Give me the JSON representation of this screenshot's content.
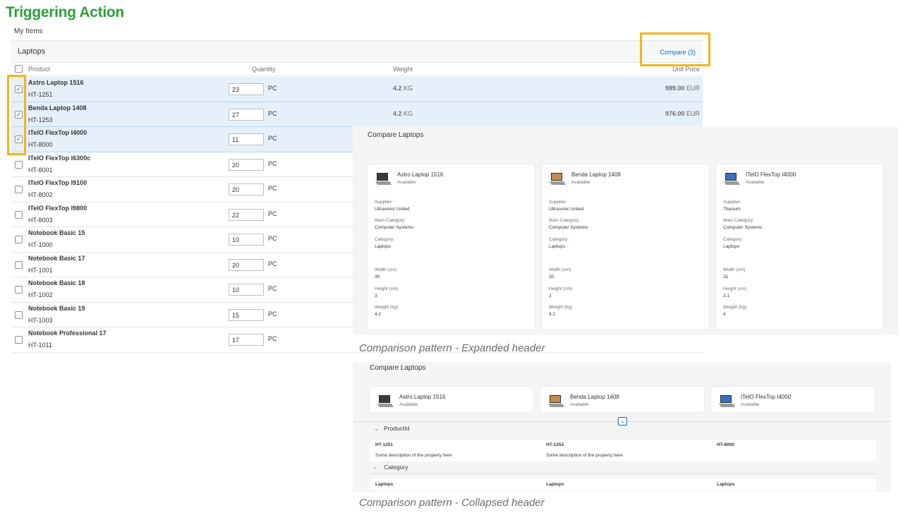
{
  "slide_title": "Triggering Action",
  "items": {
    "heading": "My Items",
    "toolbar_title": "Laptops",
    "compare_label": "Compare (3)",
    "columns": {
      "product": "Product",
      "quantity": "Quantity",
      "weight": "Weight",
      "unit_price": "Unit Price"
    },
    "rows": [
      {
        "name": "Astro Laptop 1516",
        "id": "HT-1251",
        "qty": "23",
        "unit": "PC",
        "weight": "4.2",
        "weight_unit": "KG",
        "price": "989.00",
        "currency": "EUR",
        "selected": true
      },
      {
        "name": "Benda Laptop 1408",
        "id": "HT-1253",
        "qty": "27",
        "unit": "PC",
        "weight": "4.2",
        "weight_unit": "KG",
        "price": "976.00",
        "currency": "EUR",
        "selected": true
      },
      {
        "name": "ITelO FlexTop I4000",
        "id": "HT-8000",
        "qty": "11",
        "unit": "PC",
        "selected": true
      },
      {
        "name": "ITelO FlexTop I6300c",
        "id": "HT-8001",
        "qty": "20",
        "unit": "PC",
        "selected": false
      },
      {
        "name": "ITelO FlexTop I9100",
        "id": "HT-8002",
        "qty": "20",
        "unit": "PC",
        "selected": false
      },
      {
        "name": "ITelO FlexTop I9800",
        "id": "HT-8003",
        "qty": "22",
        "unit": "PC",
        "selected": false
      },
      {
        "name": "Notebook Basic 15",
        "id": "HT-1000",
        "qty": "10",
        "unit": "PC",
        "selected": false
      },
      {
        "name": "Notebook Basic 17",
        "id": "HT-1001",
        "qty": "20",
        "unit": "PC",
        "selected": false
      },
      {
        "name": "Notebook Basic 18",
        "id": "HT-1002",
        "qty": "10",
        "unit": "PC",
        "selected": false
      },
      {
        "name": "Notebook Basic 19",
        "id": "HT-1003",
        "qty": "15",
        "unit": "PC",
        "selected": false
      },
      {
        "name": "Notebook Professional 17",
        "id": "HT-1011",
        "qty": "17",
        "unit": "PC",
        "selected": false
      }
    ]
  },
  "expanded": {
    "title": "Compare Laptops",
    "caption": "Comparison pattern - Expanded header",
    "products": [
      {
        "name": "Astro Laptop 1516",
        "status": "Available",
        "supplier": "Ultrasonic United",
        "main_category": "Computer Systems",
        "category": "Laptops",
        "width": "30",
        "height": "3",
        "weight": "4.2"
      },
      {
        "name": "Benda Laptop 1408",
        "status": "Available",
        "supplier": "Ultrasonic United",
        "main_category": "Computer Systems",
        "category": "Laptops",
        "width": "30",
        "height": "3",
        "weight": "4.2"
      },
      {
        "name": "ITelO FlexTop I4000",
        "status": "Available",
        "supplier": "Titanium",
        "main_category": "Computer Systems",
        "category": "Laptops",
        "width": "31",
        "height": "3.1",
        "weight": "4"
      }
    ],
    "labels": {
      "supplier": "Supplier:",
      "main_category": "Main Category:",
      "category": "Category:",
      "width": "Width (cm)",
      "height": "Height (cm)",
      "weight": "Weight (kg)"
    }
  },
  "collapsed": {
    "title": "Compare Laptops",
    "caption": "Comparison pattern - Collapsed header",
    "products": [
      {
        "name": "Astro Laptop 1516",
        "status": "Available"
      },
      {
        "name": "Benda Laptop 1408",
        "status": "Available"
      },
      {
        "name": "ITelO FlexTop I4000",
        "status": "Available"
      }
    ],
    "section1": "ProductId",
    "ids": [
      "HT-1251",
      "HT-1253",
      "HT-8000"
    ],
    "descriptions": [
      "Some description of the property here",
      "Some description of the property here"
    ],
    "section2": "Category",
    "categories": [
      "Laptops",
      "Laptops",
      "Laptops"
    ]
  },
  "colors": {
    "highlight": "#f5b417",
    "title_green": "#2e9e3e",
    "link": "#0a6ed1",
    "selected_row": "#e5f0fa"
  }
}
